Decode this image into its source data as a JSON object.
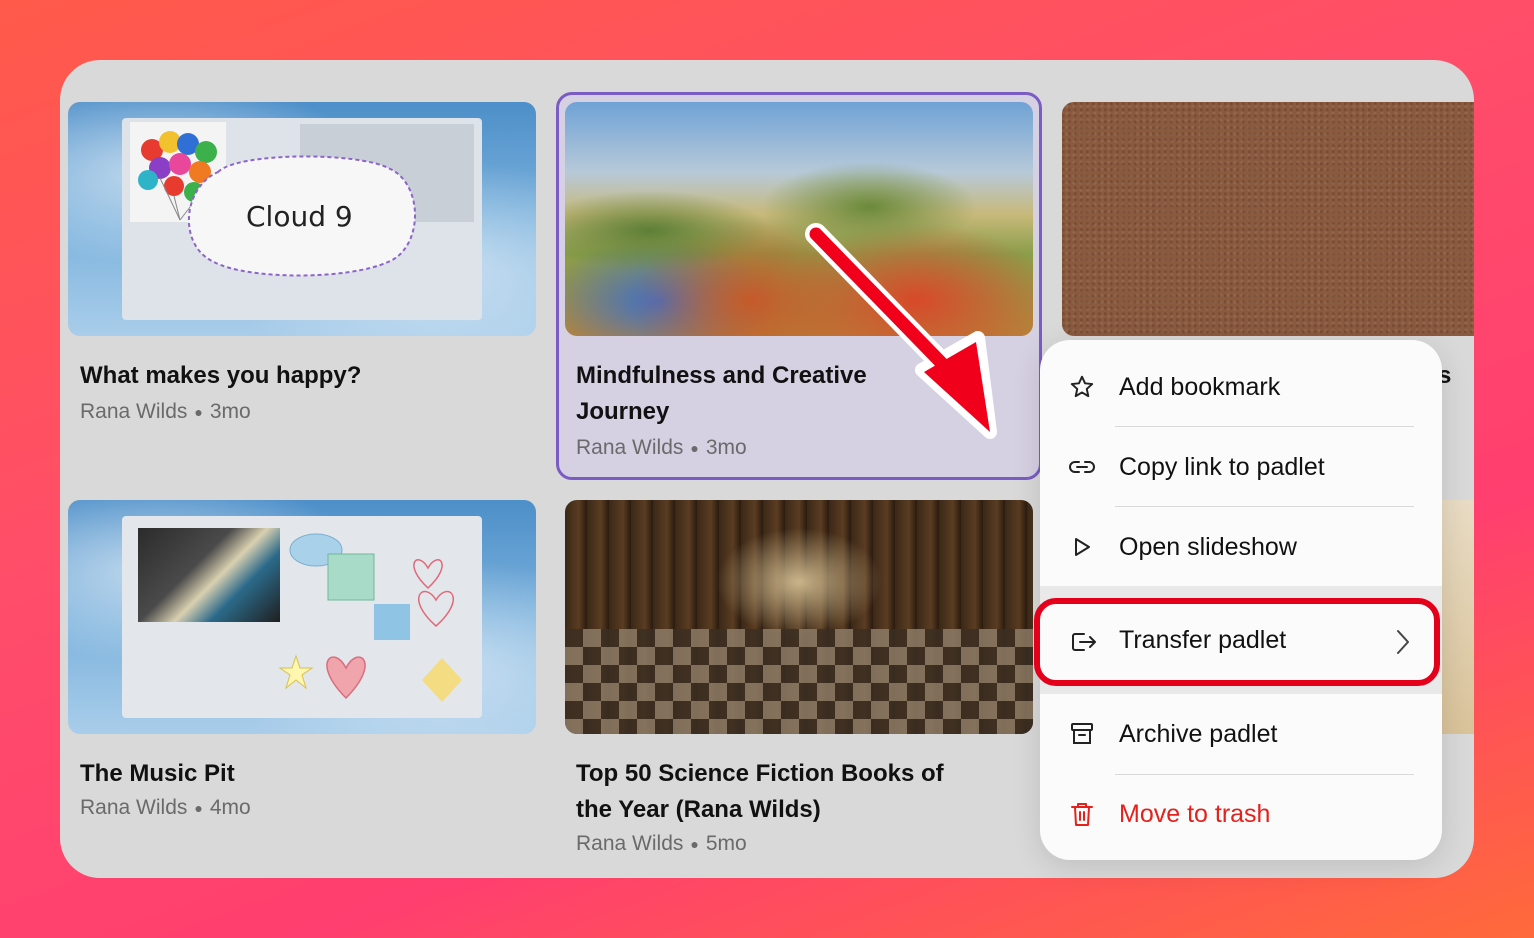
{
  "cards": [
    {
      "title": "What makes you happy?",
      "author": "Rana Wilds",
      "age": "3mo",
      "thumb_text": "Cloud 9"
    },
    {
      "title_line1": "Mindfulness and Creative",
      "title_line2": "Journey",
      "author": "Rana Wilds",
      "age": "3mo"
    },
    {
      "title": "The Music Pit",
      "author": "Rana Wilds",
      "age": "4mo"
    },
    {
      "title_line1": "Top 50 Science Fiction Books of",
      "title_line2": "the Year (Rana Wilds)",
      "author": "Rana Wilds",
      "age": "5mo"
    }
  ],
  "menu": {
    "items": [
      {
        "label": "Add bookmark",
        "icon": "star-icon"
      },
      {
        "label": "Copy link to padlet",
        "icon": "link-icon"
      },
      {
        "label": "Open slideshow",
        "icon": "play-icon"
      },
      {
        "label": "Transfer padlet",
        "icon": "transfer-icon",
        "highlighted": true
      },
      {
        "label": "Archive padlet",
        "icon": "archive-icon"
      },
      {
        "label": "Move to trash",
        "icon": "trash-icon",
        "danger": true
      }
    ]
  },
  "partial_text": "s",
  "colors": {
    "background": "#ff4d6a",
    "highlight": "#e4001b",
    "selected_border": "#7b5cc4",
    "danger": "#e4211c"
  }
}
